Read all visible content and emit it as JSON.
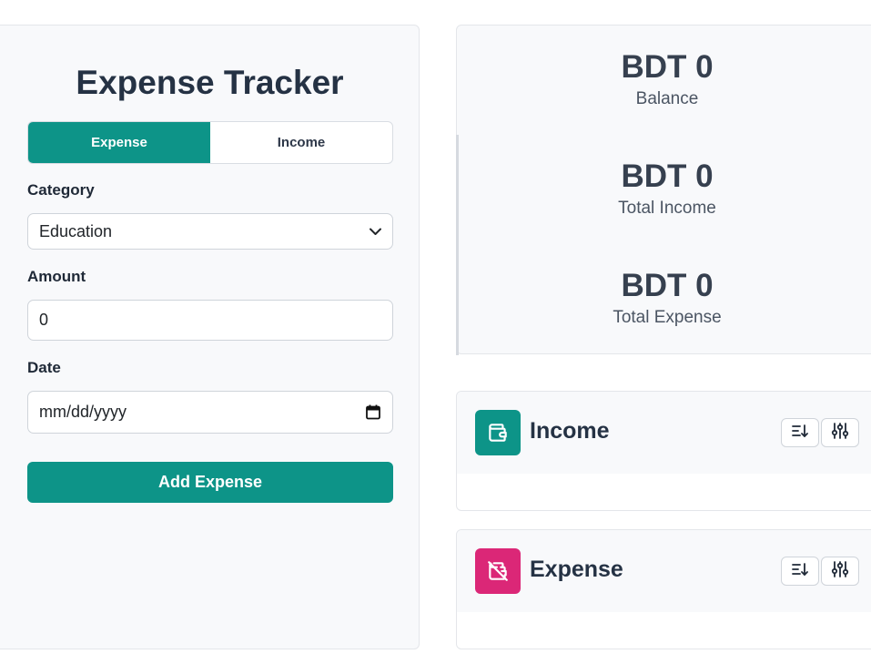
{
  "form": {
    "title": "Expense Tracker",
    "tabs": [
      {
        "label": "Expense",
        "active": true
      },
      {
        "label": "Income",
        "active": false
      }
    ],
    "category": {
      "label": "Category",
      "value": "Education"
    },
    "amount": {
      "label": "Amount",
      "value": "0"
    },
    "date": {
      "label": "Date",
      "placeholder": "mm/dd/yyyy"
    },
    "submit_label": "Add Expense"
  },
  "summary": {
    "balance": {
      "amount": "BDT 0",
      "label": "Balance"
    },
    "income": {
      "amount": "BDT 0",
      "label": "Total Income"
    },
    "expense": {
      "amount": "BDT 0",
      "label": "Total Expense"
    }
  },
  "lists": {
    "income": {
      "title": "Income",
      "icon": "wallet-icon",
      "color": "#0d9488"
    },
    "expense": {
      "title": "Expense",
      "icon": "wallet-off-icon",
      "color": "#db2777"
    }
  },
  "colors": {
    "accent": "#0d9488",
    "expense_accent": "#db2777"
  }
}
